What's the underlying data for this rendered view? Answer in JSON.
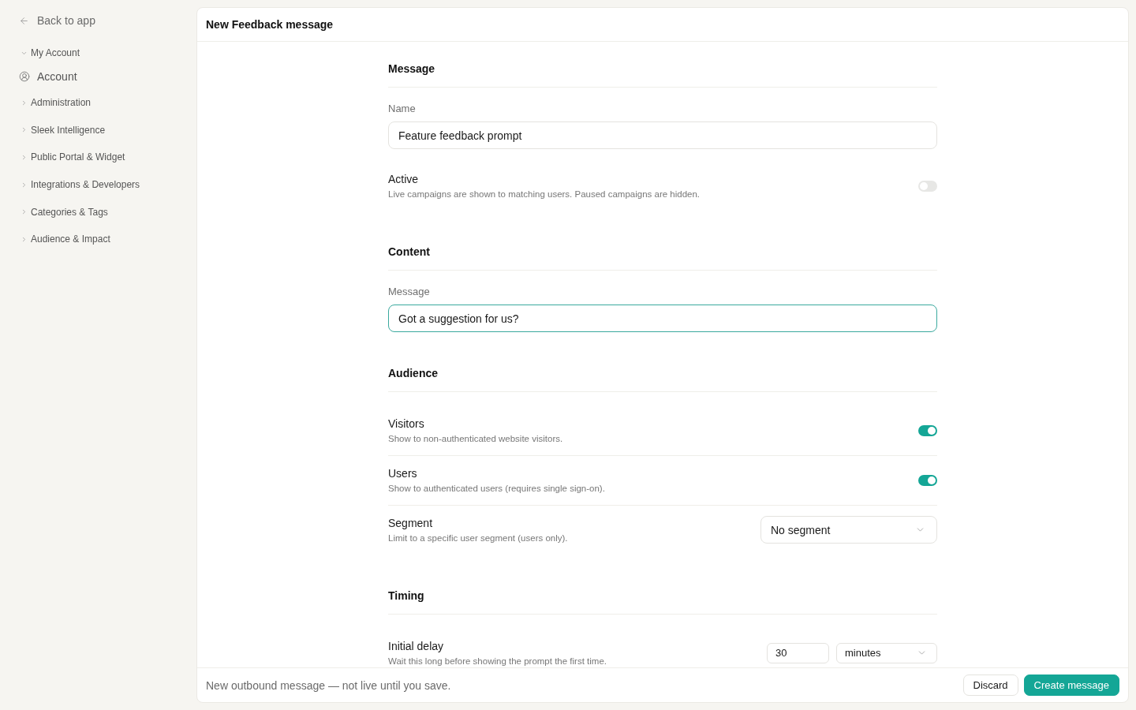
{
  "sidebar": {
    "back_link": "Back to app",
    "groups": [
      {
        "label": "My Account",
        "expanded": true,
        "children": [
          {
            "label": "Account"
          }
        ]
      },
      {
        "label": "Administration",
        "expanded": false
      },
      {
        "label": "Sleek Intelligence",
        "expanded": false
      },
      {
        "label": "Public Portal & Widget",
        "expanded": false
      },
      {
        "label": "Integrations & Developers",
        "expanded": false
      },
      {
        "label": "Categories & Tags",
        "expanded": false
      },
      {
        "label": "Audience & Impact",
        "expanded": false
      }
    ]
  },
  "panel": {
    "title": "New Feedback message"
  },
  "sections": [
    {
      "heading": "Message",
      "rows": [
        {
          "kind": "text",
          "label": "Name",
          "value": "Feature feedback prompt",
          "focused": false
        },
        {
          "kind": "toggle",
          "title": "Active",
          "description": "Live campaigns are shown to matching users. Paused campaigns are hidden.",
          "on": false
        }
      ]
    },
    {
      "heading": "Content",
      "rows": [
        {
          "kind": "text",
          "label": "Message",
          "value": "Got a suggestion for us?",
          "focused": true
        }
      ]
    },
    {
      "heading": "Audience",
      "rows": [
        {
          "kind": "toggle",
          "title": "Visitors",
          "description": "Show to non-authenticated website visitors.",
          "on": true
        },
        {
          "kind": "toggle",
          "title": "Users",
          "description": "Show to authenticated users (requires single sign-on).",
          "on": true
        },
        {
          "kind": "select",
          "title": "Segment",
          "description": "Limit to a specific user segment (users only).",
          "value": "No segment"
        }
      ]
    },
    {
      "heading": "Timing",
      "rows": [
        {
          "kind": "delay",
          "title": "Initial delay",
          "description": "Wait this long before showing the prompt the first time.",
          "value": "30",
          "unit": "minutes"
        }
      ]
    }
  ],
  "footer": {
    "status": "New outbound message — not live until you save.",
    "buttons": [
      {
        "label": "Discard",
        "kind": "secondary"
      },
      {
        "label": "Create message",
        "kind": "primary"
      }
    ]
  }
}
